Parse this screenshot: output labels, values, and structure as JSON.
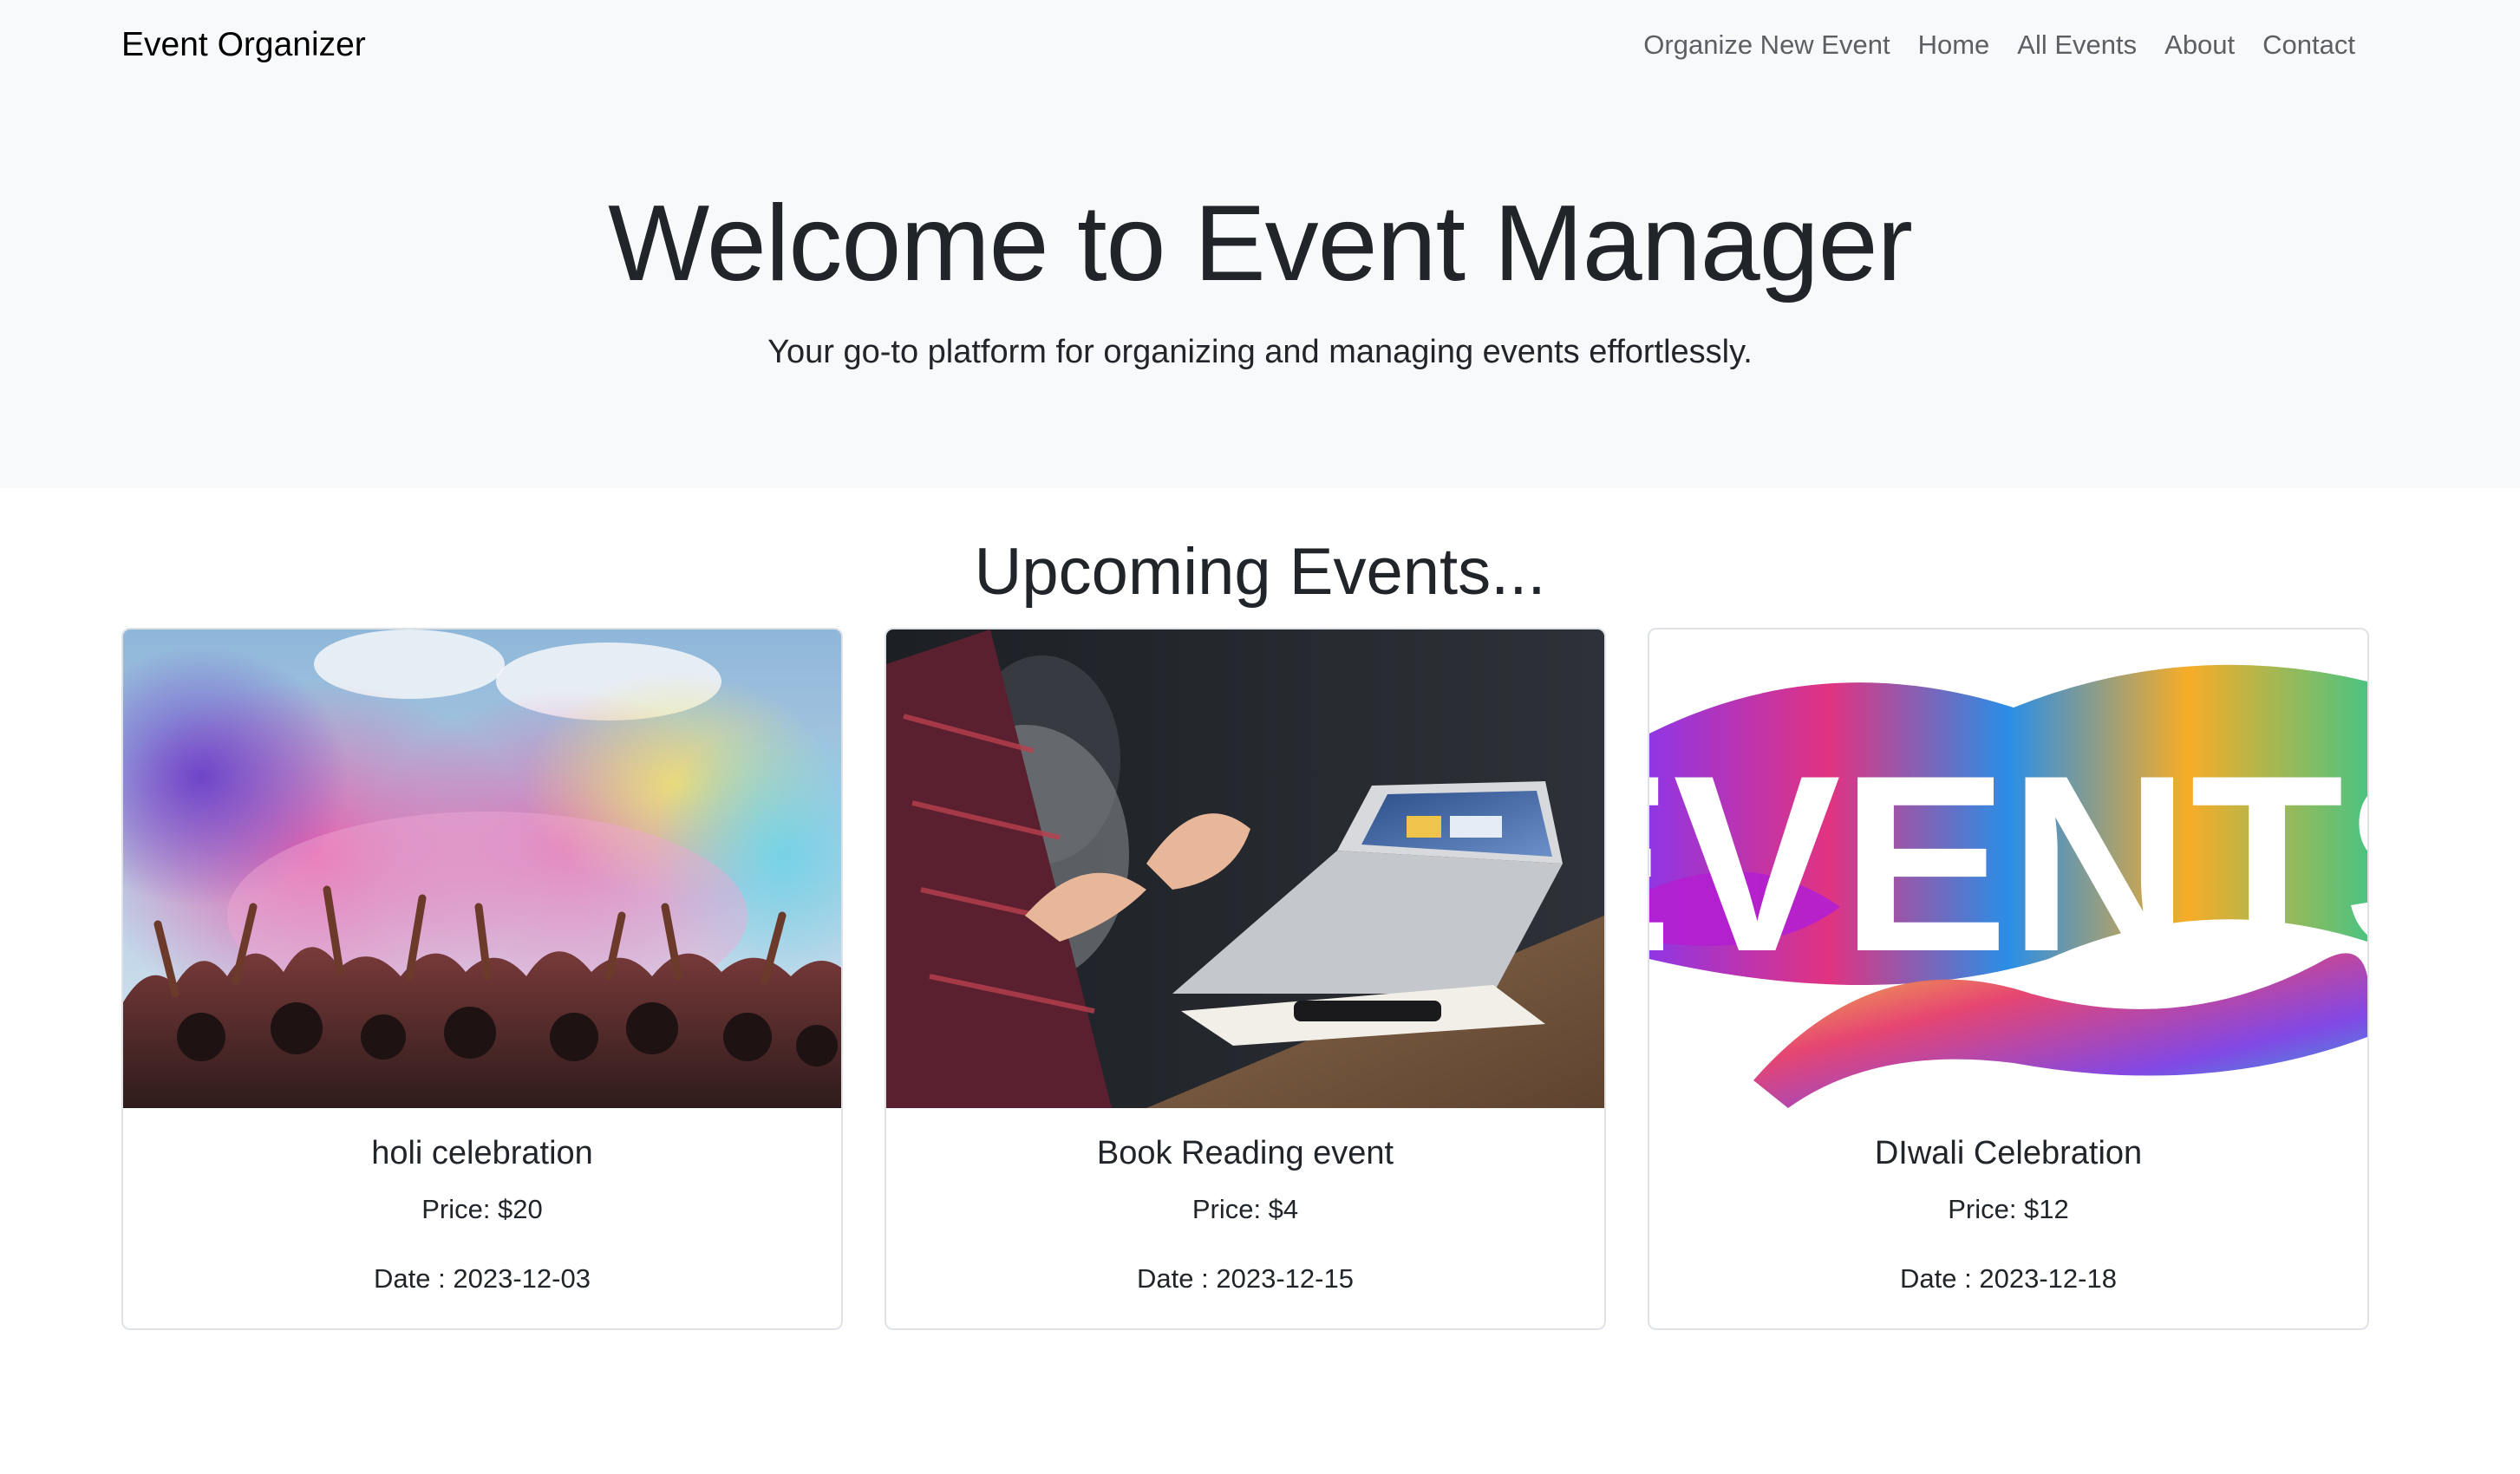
{
  "navbar": {
    "brand": "Event Organizer",
    "links": [
      "Organize New Event",
      "Home",
      "All Events",
      "About",
      "Contact"
    ]
  },
  "hero": {
    "title": "Welcome to Event Manager",
    "subtitle": "Your go-to platform for organizing and managing events effortlessly."
  },
  "events_section": {
    "title": "Upcoming Events...",
    "cards": [
      {
        "image": "holi-color-crowd-photo",
        "title": "holi celebration",
        "price": "Price: $20",
        "date": "Date : 2023-12-03"
      },
      {
        "image": "book-reading-meeting-laptop-photo",
        "title": "Book Reading event",
        "price": "Price: $4",
        "date": "Date : 2023-12-15"
      },
      {
        "image": "events-colorful-paint-banner",
        "image_text": "EVENTS",
        "title": "DIwali Celebration",
        "price": "Price: $12",
        "date": "Date : 2023-12-18"
      }
    ]
  }
}
